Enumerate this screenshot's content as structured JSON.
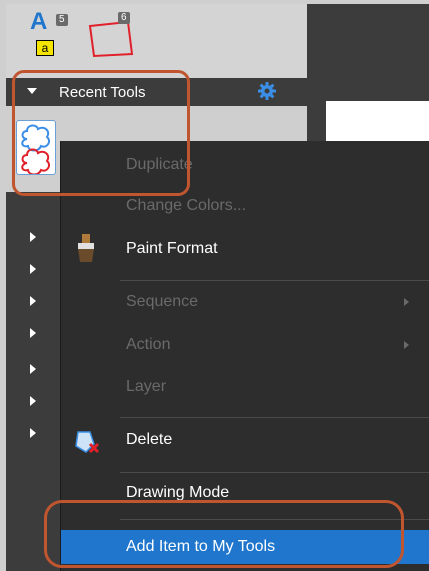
{
  "recent_tools": {
    "label": "Recent Tools"
  },
  "top_tools": {
    "text_tool_letter": "A",
    "text_tool_badge": "5",
    "text_tool_sub": "a",
    "shape_tool_badge": "6"
  },
  "context_menu": {
    "items": [
      {
        "label": "Duplicate",
        "enabled": false
      },
      {
        "label": "Change Colors...",
        "enabled": false
      },
      {
        "label": "Paint Format",
        "enabled": true,
        "icon": "paintbrush-icon"
      },
      {
        "label": "Sequence",
        "enabled": false,
        "submenu": true
      },
      {
        "label": "Action",
        "enabled": false,
        "submenu": true
      },
      {
        "label": "Layer",
        "enabled": false
      },
      {
        "label": "Delete",
        "enabled": true,
        "icon": "delete-icon"
      },
      {
        "label": "Drawing Mode",
        "enabled": true
      },
      {
        "label": "Add Item to My Tools",
        "enabled": true,
        "highlighted": true
      }
    ]
  },
  "colors": {
    "accent": "#1f76cc",
    "annotation": "#c0562f",
    "menu_bg": "#2d2d2d"
  }
}
